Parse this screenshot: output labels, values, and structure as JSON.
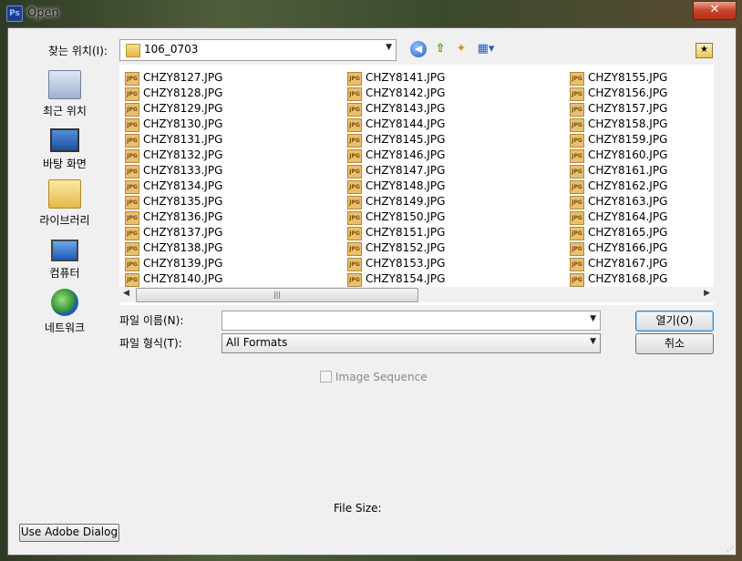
{
  "window": {
    "title": "Open",
    "app_icon": "Ps",
    "close_label": "✕"
  },
  "toolbar": {
    "lookin_label": "찾는 위치(I):",
    "lookin_value": "106_0703",
    "icons": [
      "back-icon",
      "up-folder-icon",
      "new-folder-icon",
      "view-menu-icon",
      "adobe-folder-icon"
    ]
  },
  "places": [
    {
      "label": "최근 위치",
      "icon": "recent-places-icon"
    },
    {
      "label": "바탕 화면",
      "icon": "desktop-icon"
    },
    {
      "label": "라이브러리",
      "icon": "libraries-icon"
    },
    {
      "label": "컴퓨터",
      "icon": "computer-icon"
    },
    {
      "label": "네트워크",
      "icon": "network-icon"
    }
  ],
  "files": {
    "icon_text": "JPG",
    "col1": [
      "CHZY8127.JPG",
      "CHZY8128.JPG",
      "CHZY8129.JPG",
      "CHZY8130.JPG",
      "CHZY8131.JPG",
      "CHZY8132.JPG",
      "CHZY8133.JPG",
      "CHZY8134.JPG",
      "CHZY8135.JPG",
      "CHZY8136.JPG",
      "CHZY8137.JPG",
      "CHZY8138.JPG",
      "CHZY8139.JPG",
      "CHZY8140.JPG"
    ],
    "col2": [
      "CHZY8141.JPG",
      "CHZY8142.JPG",
      "CHZY8143.JPG",
      "CHZY8144.JPG",
      "CHZY8145.JPG",
      "CHZY8146.JPG",
      "CHZY8147.JPG",
      "CHZY8148.JPG",
      "CHZY8149.JPG",
      "CHZY8150.JPG",
      "CHZY8151.JPG",
      "CHZY8152.JPG",
      "CHZY8153.JPG",
      "CHZY8154.JPG"
    ],
    "col3": [
      "CHZY8155.JPG",
      "CHZY8156.JPG",
      "CHZY8157.JPG",
      "CHZY8158.JPG",
      "CHZY8159.JPG",
      "CHZY8160.JPG",
      "CHZY8161.JPG",
      "CHZY8162.JPG",
      "CHZY8163.JPG",
      "CHZY8164.JPG",
      "CHZY8165.JPG",
      "CHZY8166.JPG",
      "CHZY8167.JPG",
      "CHZY8168.JPG"
    ]
  },
  "form": {
    "filename_label": "파일 이름(N):",
    "filename_value": "",
    "filetype_label": "파일 형식(T):",
    "filetype_value": "All Formats",
    "open_button": "열기(O)",
    "cancel_button": "취소",
    "image_sequence_label": "Image Sequence",
    "image_sequence_checked": false,
    "file_size_label": "File Size:",
    "adobe_dialog_button": "Use Adobe Dialog"
  }
}
